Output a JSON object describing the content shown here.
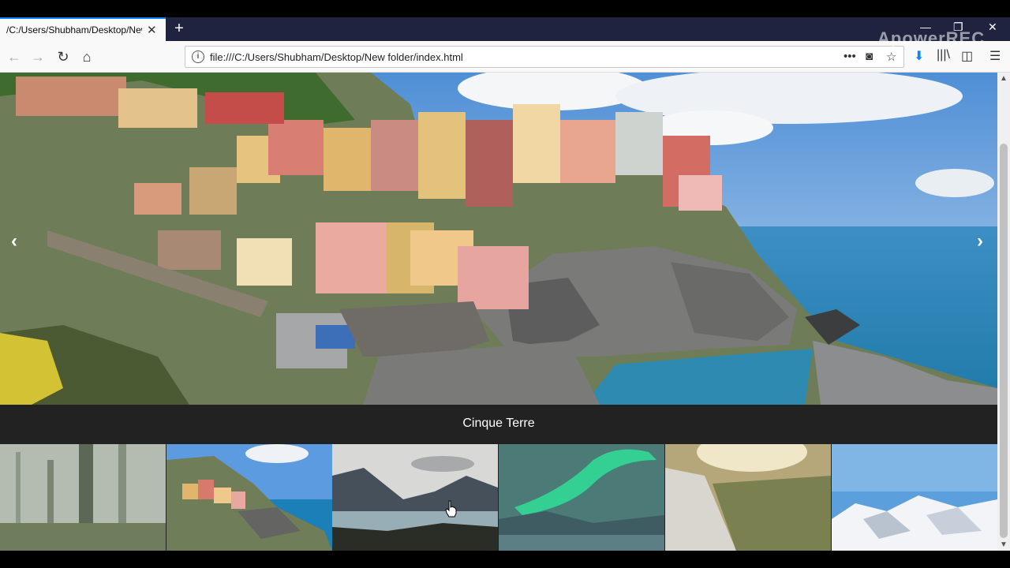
{
  "browser": {
    "tab_title": "/C:/Users/Shubham/Desktop/New folder/index.html",
    "tab_close": "✕",
    "new_tab": "+",
    "url": "file:///C:/Users/Shubham/Desktop/New folder/index.html",
    "window_controls": [
      "—",
      "❐",
      "✕"
    ],
    "watermark": "ApowerREC",
    "icons": [
      "back-icon",
      "forward-icon",
      "reload-icon",
      "home-icon",
      "info-icon",
      "more-icon",
      "pocket-icon",
      "bookmark-star-icon",
      "download-icon",
      "library-icon",
      "sidebar-icon",
      "menu-icon"
    ]
  },
  "slideshow": {
    "caption": "Cinque Terre",
    "prev_arrow": "‹",
    "next_arrow": "›",
    "thumbnails": [
      "forest",
      "cinque-terre",
      "mountains",
      "northern-lights",
      "waterfall-valley",
      "snowy-mountains"
    ]
  },
  "colors": {
    "tabstrip": "#202340",
    "accent": "#0a84ff",
    "caption_bg": "#222222"
  }
}
